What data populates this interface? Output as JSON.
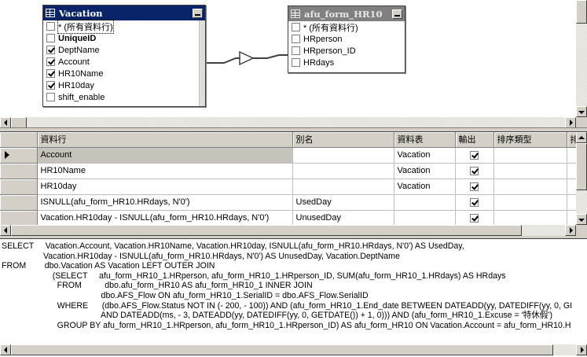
{
  "diagram": {
    "tables": [
      {
        "title": "Vacation",
        "active": true,
        "fields": [
          {
            "label": "* (所有資料行)",
            "checked": false,
            "bold": false,
            "focused": true
          },
          {
            "label": "UniqueID",
            "checked": false,
            "bold": true,
            "focused": false
          },
          {
            "label": "DeptName",
            "checked": true,
            "bold": false,
            "focused": false
          },
          {
            "label": "Account",
            "checked": true,
            "bold": false,
            "focused": false
          },
          {
            "label": "HR10Name",
            "checked": true,
            "bold": false,
            "focused": false
          },
          {
            "label": "HR10day",
            "checked": true,
            "bold": false,
            "focused": false
          },
          {
            "label": "shift_enable",
            "checked": false,
            "bold": false,
            "focused": false
          }
        ]
      },
      {
        "title": "afu_form_HR10",
        "active": false,
        "fields": [
          {
            "label": "* (所有資料行)",
            "checked": false,
            "bold": false,
            "focused": false
          },
          {
            "label": "HRperson",
            "checked": false,
            "bold": false,
            "focused": false
          },
          {
            "label": "HRperson_ID",
            "checked": false,
            "bold": false,
            "focused": false
          },
          {
            "label": "HRdays",
            "checked": false,
            "bold": false,
            "focused": false
          }
        ]
      }
    ]
  },
  "grid": {
    "columns": [
      "",
      "資料行",
      "別名",
      "資料表",
      "輸出",
      "排序類型",
      "排"
    ],
    "rows": [
      {
        "column": "Account",
        "alias": "",
        "table": "Vacation",
        "output": true,
        "sort": "",
        "current": true
      },
      {
        "column": "HR10Name",
        "alias": "",
        "table": "Vacation",
        "output": true,
        "sort": "",
        "current": false
      },
      {
        "column": "HR10day",
        "alias": "",
        "table": "Vacation",
        "output": true,
        "sort": "",
        "current": false
      },
      {
        "column": "ISNULL(afu_form_HR10.HRdays, N'0')",
        "alias": "UsedDay",
        "table": "",
        "output": true,
        "sort": "",
        "current": false
      },
      {
        "column": "Vacation.HR10day - ISNULL(afu_form_HR10.HRdays, N'0')",
        "alias": "UnusedDay",
        "table": "",
        "output": true,
        "sort": "",
        "current": false
      }
    ]
  },
  "sql": {
    "lines": [
      "SELECT     Vacation.Account, Vacation.HR10Name, Vacation.HR10day, ISNULL(afu_form_HR10.HRdays, N'0') AS UsedDay,",
      "                  Vacation.HR10day - ISNULL(afu_form_HR10.HRdays, N'0') AS UnusedDay, Vacation.DeptName",
      "FROM        dbo.Vacation AS Vacation LEFT OUTER JOIN",
      "                      (SELECT     afu_form_HR10_1.HRperson, afu_form_HR10_1.HRperson_ID, SUM(afu_form_HR10_1.HRdays) AS HRdays",
      "                        FROM          dbo.afu_form_HR10 AS afu_form_HR10_1 INNER JOIN",
      "                                           dbo.AFS_Flow ON afu_form_HR10_1.SerialID = dbo.AFS_Flow.SerialID",
      "                        WHERE      (dbo.AFS_Flow.Status NOT IN (- 200, - 100)) AND (afu_form_HR10_1.End_date BETWEEN DATEADD(yy, DATEDIFF(yy, 0, GI",
      "                                           AND DATEADD(ms, - 3, DATEADD(yy, DATEDIFF(yy, 0, GETDATE()) + 1, 0))) AND (afu_form_HR10_1.Excuse = '特休假')",
      "                        GROUP BY afu_form_HR10_1.HRperson, afu_form_HR10_1.HRperson_ID) AS afu_form_HR10 ON Vacation.Account = afu_form_HR10.H"
    ]
  }
}
